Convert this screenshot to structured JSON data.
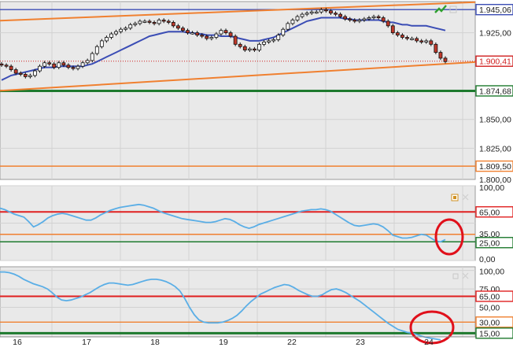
{
  "colors": {
    "panel_bg": "#e9e9e9",
    "grid": "#d2d2d2",
    "candle_up": "#ffffff",
    "candle_down": "#c0392b",
    "candle_wick": "#111111",
    "moving_average": "#3b4db5",
    "channel": "#f08030",
    "support": "#1e7a2e",
    "resistance_blue": "#3b4db5",
    "oscillator_line": "#5aaee6",
    "level_red": "#e02020",
    "level_orange": "#f08030",
    "level_green": "#1e7a2e",
    "highlight_circle": "#e0101b",
    "price_label_red": "#d02020"
  },
  "chart_data": [
    {
      "type": "candlestick",
      "panel": "price",
      "x_tick_labels": [
        "16",
        "17",
        "18",
        "19",
        "22",
        "23",
        "24"
      ],
      "y_tick_labels": [
        "1.945,06",
        "1.925,00",
        "1.900,41",
        "1.874,68",
        "1.850,00",
        "1.825,00",
        "1.809,50",
        "1.800,00"
      ],
      "ylim": [
        1798,
        1952
      ],
      "grid": true,
      "closes": [
        1897,
        1896,
        1893,
        1890,
        1889,
        1887,
        1888,
        1892,
        1896,
        1899,
        1898,
        1895,
        1899,
        1897,
        1895,
        1894,
        1896,
        1899,
        1901,
        1907,
        1913,
        1918,
        1921,
        1924,
        1926,
        1928,
        1929,
        1932,
        1933,
        1935,
        1935,
        1934,
        1933,
        1936,
        1935,
        1934,
        1931,
        1929,
        1927,
        1925,
        1925,
        1923,
        1922,
        1920,
        1921,
        1924,
        1927,
        1925,
        1922,
        1915,
        1913,
        1910,
        1911,
        1910,
        1915,
        1917,
        1918,
        1919,
        1923,
        1928,
        1933,
        1936,
        1939,
        1941,
        1942,
        1943,
        1943,
        1945,
        1944,
        1942,
        1941,
        1939,
        1937,
        1936,
        1935,
        1936,
        1937,
        1938,
        1939,
        1938,
        1935,
        1931,
        1925,
        1923,
        1921,
        1920,
        1920,
        1918,
        1917,
        1918,
        1915,
        1908,
        1903,
        1900
      ],
      "moving_average": [
        1884,
        1886,
        1888,
        1889,
        1890,
        1891,
        1892,
        1893,
        1894,
        1895,
        1895,
        1895,
        1896,
        1896,
        1896,
        1896,
        1896,
        1896,
        1897,
        1898,
        1900,
        1902,
        1904,
        1906,
        1908,
        1910,
        1912,
        1914,
        1916,
        1918,
        1920,
        1922,
        1923,
        1924,
        1925,
        1926,
        1926,
        1926,
        1926,
        1925,
        1925,
        1924,
        1924,
        1923,
        1923,
        1923,
        1922,
        1922,
        1922,
        1921,
        1920,
        1919,
        1918,
        1918,
        1918,
        1919,
        1920,
        1921,
        1923,
        1925,
        1927,
        1929,
        1931,
        1933,
        1935,
        1936,
        1937,
        1938,
        1938,
        1938,
        1938,
        1938,
        1937,
        1937,
        1936,
        1936,
        1936,
        1936,
        1936,
        1936,
        1935,
        1934,
        1934,
        1933,
        1932,
        1932,
        1931,
        1931,
        1931,
        1931,
        1930,
        1929,
        1928,
        1927
      ],
      "channel_upper": [
        1935.5,
        1951.5
      ],
      "channel_lower": [
        1874.8,
        1899.6
      ],
      "horizontal_levels": [
        1945.06,
        1900.41,
        1874.68,
        1809.5
      ]
    },
    {
      "type": "line",
      "panel": "oscillator-1",
      "y_tick_labels": [
        "100,00",
        "65,00",
        "35,00",
        "25,00",
        "0,00"
      ],
      "ylim": [
        0,
        100
      ],
      "levels": [
        65,
        35,
        25
      ],
      "values": [
        70,
        68,
        65,
        62,
        60,
        58,
        52,
        45,
        48,
        52,
        57,
        60,
        62,
        63,
        62,
        60,
        58,
        56,
        54,
        54,
        57,
        61,
        64,
        67,
        69,
        71,
        72,
        73,
        74,
        75,
        74,
        72,
        70,
        67,
        64,
        62,
        60,
        58,
        56,
        55,
        54,
        53,
        52,
        51,
        51,
        52,
        54,
        56,
        55,
        52,
        48,
        45,
        43,
        45,
        48,
        50,
        52,
        54,
        56,
        58,
        60,
        62,
        64,
        66,
        67,
        68,
        68,
        69,
        68,
        66,
        62,
        58,
        54,
        50,
        47,
        46,
        47,
        48,
        49,
        48,
        45,
        40,
        34,
        32,
        30,
        30,
        31,
        33,
        35,
        34,
        30,
        26,
        25,
        28
      ]
    },
    {
      "type": "line",
      "panel": "oscillator-2",
      "x_tick_labels": [
        "16",
        "17",
        "18",
        "19",
        "22",
        "23",
        "24"
      ],
      "y_tick_labels": [
        "100,00",
        "75,00",
        "65,00",
        "50,00",
        "30,00",
        "15,00"
      ],
      "ylim": [
        10,
        105
      ],
      "levels": [
        65,
        30,
        15
      ],
      "values": [
        98,
        98,
        97,
        95,
        92,
        88,
        85,
        82,
        80,
        78,
        75,
        70,
        64,
        60,
        59,
        60,
        62,
        64,
        67,
        70,
        74,
        78,
        81,
        83,
        83,
        82,
        81,
        80,
        81,
        83,
        85,
        87,
        88,
        88,
        87,
        85,
        82,
        78,
        72,
        62,
        50,
        40,
        33,
        30,
        29,
        29,
        29,
        30,
        32,
        35,
        39,
        45,
        52,
        58,
        63,
        68,
        71,
        74,
        77,
        79,
        81,
        80,
        77,
        73,
        70,
        67,
        65,
        65,
        67,
        71,
        74,
        75,
        73,
        70,
        66,
        62,
        58,
        53,
        48,
        43,
        38,
        33,
        28,
        24,
        20,
        18,
        16,
        15,
        13,
        11,
        9,
        8,
        7,
        6
      ]
    }
  ]
}
